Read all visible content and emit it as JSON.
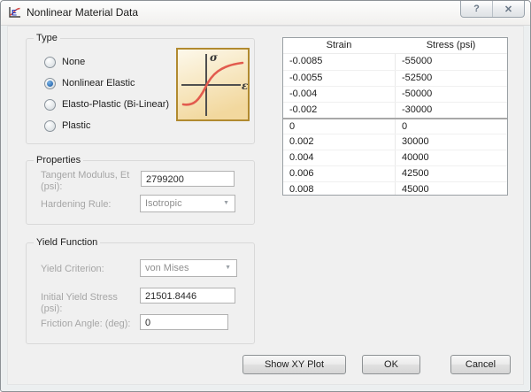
{
  "window": {
    "title": "Nonlinear Material Data",
    "help_glyph": "?",
    "close_glyph": "✕"
  },
  "type_group": {
    "label": "Type",
    "options": [
      {
        "label": "None",
        "selected": false
      },
      {
        "label": "Nonlinear Elastic",
        "selected": true
      },
      {
        "label": "Elasto-Plastic (Bi-Linear)",
        "selected": false
      },
      {
        "label": "Plastic",
        "selected": false
      }
    ],
    "preview": {
      "y_axis_label": "σ",
      "x_axis_label": "ε"
    }
  },
  "properties_group": {
    "label": "Properties",
    "fields": {
      "tangent_modulus": {
        "label": "Tangent Modulus, Et (psi):",
        "value": "2799200"
      },
      "hardening_rule": {
        "label": "Hardening Rule:",
        "value": "Isotropic"
      }
    }
  },
  "yield_group": {
    "label": "Yield Function",
    "fields": {
      "yield_criterion": {
        "label": "Yield Criterion:",
        "value": "von Mises"
      },
      "initial_yield_stress": {
        "label": "Initial Yield Stress (psi):",
        "value": "21501.8446"
      },
      "friction_angle": {
        "label": "Friction Angle: (deg):",
        "value": "0"
      }
    }
  },
  "table": {
    "columns": [
      "Strain",
      "Stress (psi)"
    ],
    "rows": [
      [
        "-0.0085",
        "-55000"
      ],
      [
        "-0.0055",
        "-52500"
      ],
      [
        "-0.004",
        "-50000"
      ],
      [
        "-0.002",
        "-30000"
      ],
      [
        "0",
        "0"
      ],
      [
        "0.002",
        "30000"
      ],
      [
        "0.004",
        "40000"
      ],
      [
        "0.006",
        "42500"
      ],
      [
        "0.008",
        "45000"
      ]
    ],
    "divider_before_row": 4
  },
  "buttons": {
    "show_xy_plot": "Show XY Plot",
    "ok": "OK",
    "cancel": "Cancel"
  },
  "colors": {
    "radio_selected": "#2f6fb4",
    "preview_border": "#b18a2f",
    "preview_bg_top": "#fdf9ec",
    "preview_bg_bottom": "#f2d89e",
    "preview_curve": "#e25b4e",
    "disabled_label": "#a6a6a6"
  }
}
